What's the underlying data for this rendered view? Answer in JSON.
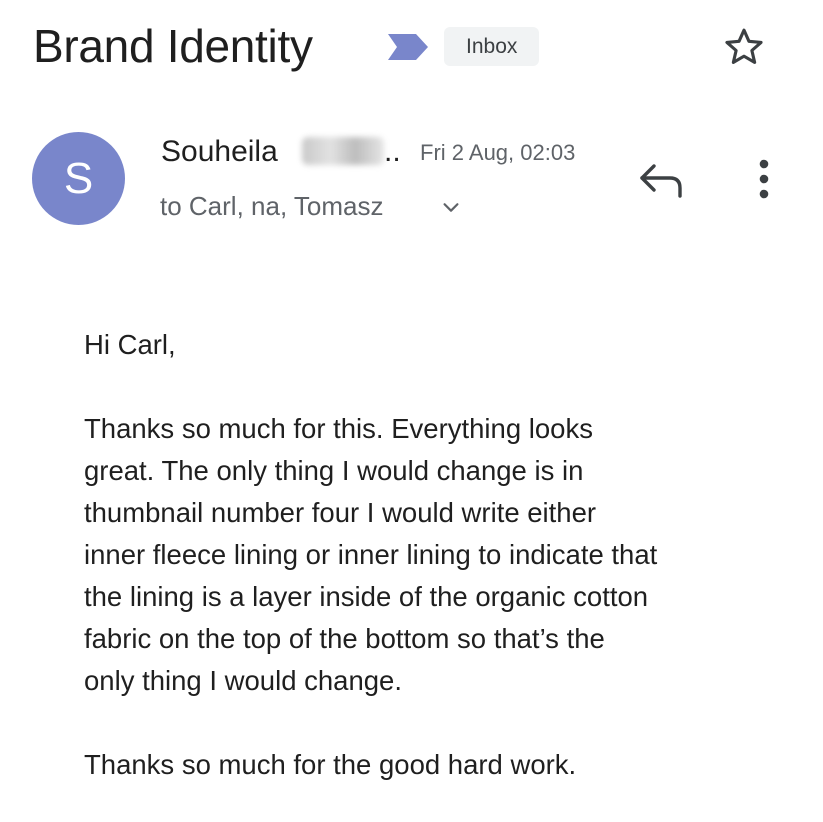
{
  "email": {
    "subject": "Brand Identity",
    "label": "Inbox",
    "importance_icon": "importance-marker-icon",
    "star_icon": "star-outline-icon",
    "sender": {
      "avatar_letter": "S",
      "avatar_color": "#7986cb",
      "name": "Souheila",
      "name_truncation": "..",
      "date": "Fri 2 Aug, 02:03",
      "recipients": "to Carl, na, Tomasz"
    },
    "actions": {
      "reply_icon": "reply-icon",
      "more_icon": "more-vert-icon",
      "expand_recipients_icon": "chevron-down-icon"
    },
    "body": {
      "greeting": "Hi Carl,",
      "paragraph_lines": [
        "Thanks so much for this. Everything looks",
        "great. The only thing I would change is in",
        "thumbnail number four I would write either",
        "inner fleece lining or inner lining to indicate that",
        "the lining is a layer inside of the organic cotton",
        "fabric on the top of the bottom so that’s the",
        "only thing I would change."
      ],
      "closing": "Thanks so much for the good hard work."
    }
  },
  "colors": {
    "importance": "#7986cb",
    "chip_background": "#f1f3f4",
    "secondary_text": "#5f6368"
  }
}
